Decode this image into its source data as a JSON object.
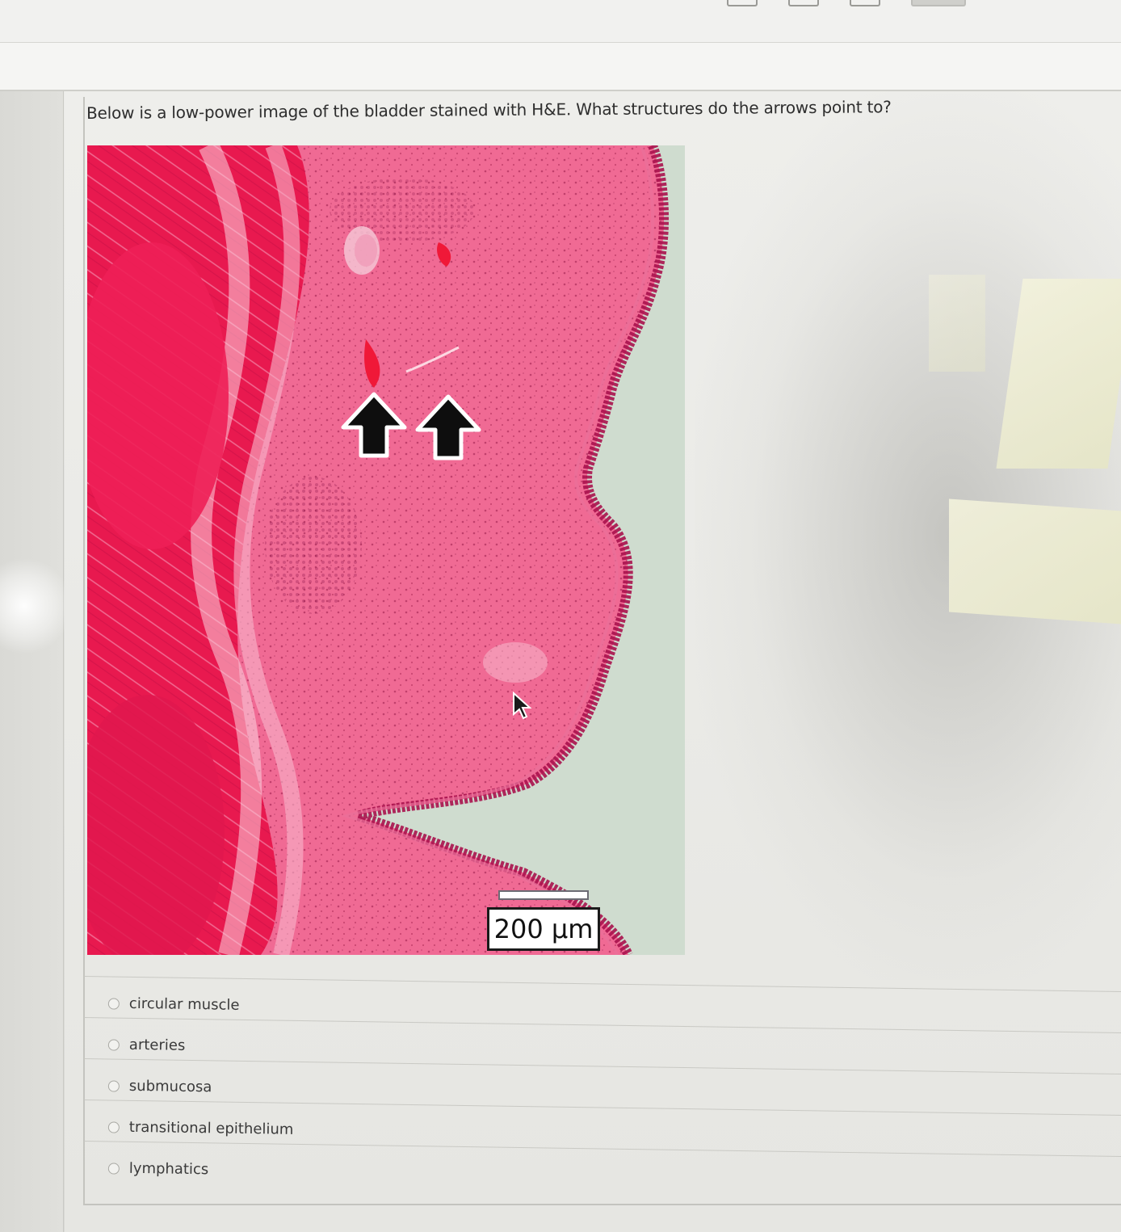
{
  "question": {
    "prompt": "Below is a low-power image of the bladder stained with H&E. What structures do the arrows point to?"
  },
  "image": {
    "scale_label": "200 µm",
    "stain_colors": {
      "muscle": "#e8194f",
      "lamina": "#f06a94",
      "epithelium": "#c21a55",
      "background": "#cfdccf"
    }
  },
  "options": [
    {
      "label": "circular muscle"
    },
    {
      "label": "arteries"
    },
    {
      "label": "submucosa"
    },
    {
      "label": "transitional epithelium"
    },
    {
      "label": "lymphatics"
    }
  ],
  "icons": {
    "arrow": "up-arrow-icon",
    "cursor": "mouse-pointer-icon"
  }
}
